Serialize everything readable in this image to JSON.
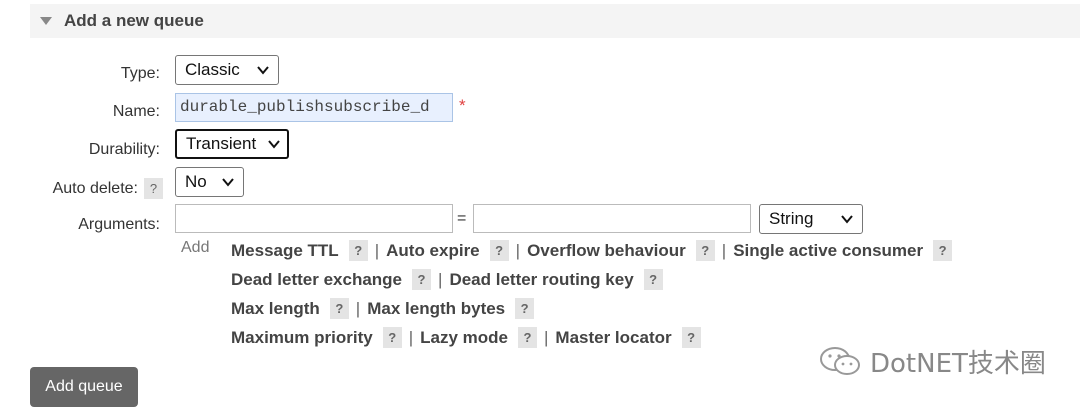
{
  "section": {
    "title": "Add a new queue"
  },
  "form": {
    "type_label": "Type:",
    "type_value": "Classic",
    "name_label": "Name:",
    "name_value": "durable_publishsubscribe_d",
    "required_mark": "*",
    "durability_label": "Durability:",
    "durability_value": "Transient",
    "auto_delete_label": "Auto delete:",
    "auto_delete_value": "No",
    "arguments_label": "Arguments:",
    "arguments_equals": "=",
    "arguments_type_value": "String",
    "help_mark": "?"
  },
  "argument_shortcuts": {
    "add_label": "Add",
    "rows": [
      [
        "Message TTL",
        "Auto expire",
        "Overflow behaviour",
        "Single active consumer"
      ],
      [
        "Dead letter exchange",
        "Dead letter routing key"
      ],
      [
        "Max length",
        "Max length bytes"
      ],
      [
        "Maximum priority",
        "Lazy mode",
        "Master locator"
      ]
    ]
  },
  "actions": {
    "add_queue_label": "Add queue"
  },
  "watermark": {
    "text": "DotNET技术圈"
  }
}
